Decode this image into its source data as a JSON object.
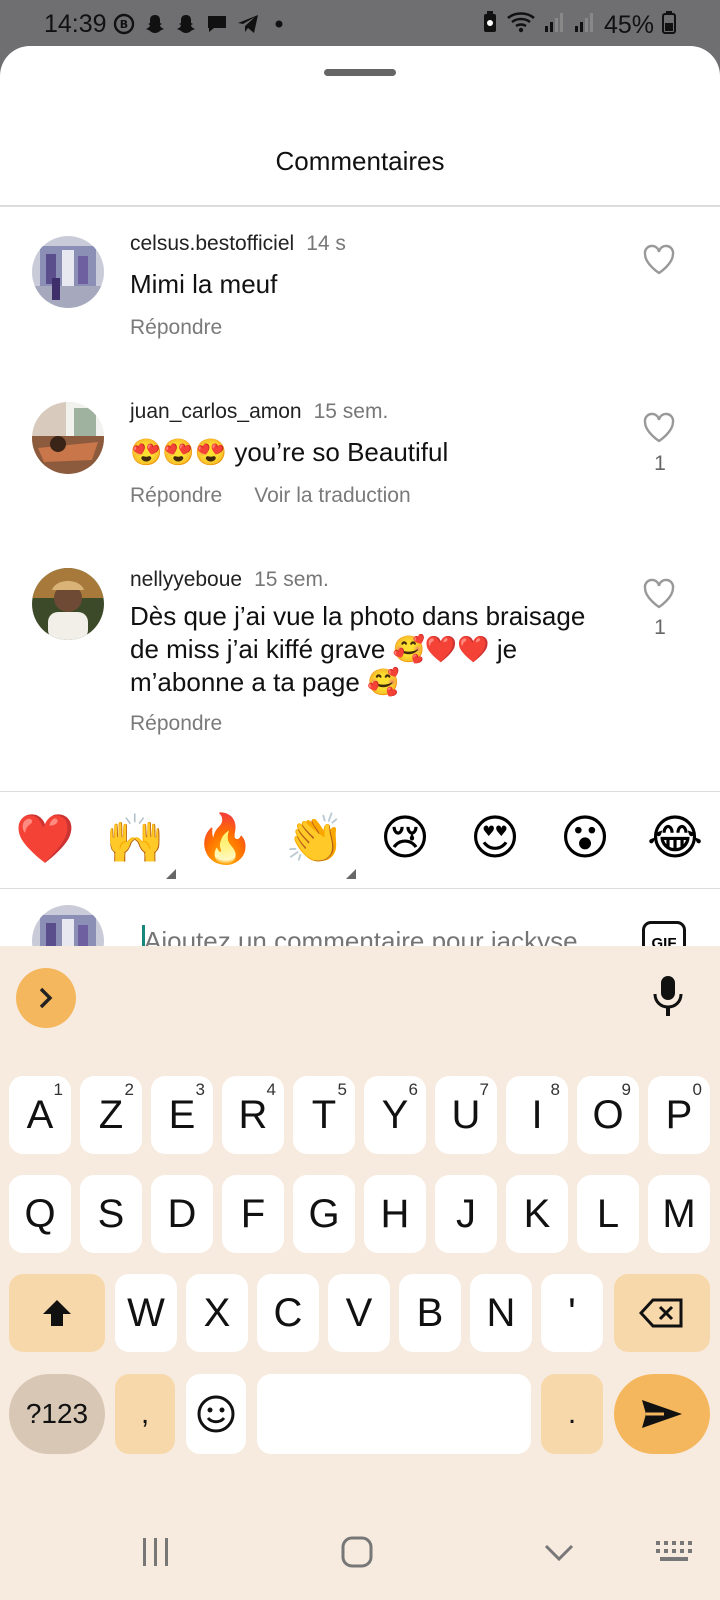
{
  "status_bar": {
    "time": "14:39",
    "battery": "45%",
    "left_icons": [
      "whatsapp-icon",
      "snapchat-icon",
      "snapchat-icon",
      "message-icon",
      "telegram-icon",
      "dot-icon"
    ],
    "right_icons": [
      "battery-saver-icon",
      "wifi-icon",
      "signal-icon",
      "signal-icon",
      "battery-icon"
    ]
  },
  "sheet": {
    "title": "Commentaires"
  },
  "comments": [
    {
      "username": "celsus.bestofficiel",
      "time": "14 s",
      "text": "Mimi la meuf",
      "reply": "Répondre",
      "translate": "",
      "likes": ""
    },
    {
      "username": "juan_carlos_amon",
      "time": "15 sem.",
      "text": "😍😍😍 you’re so Beautiful",
      "reply": "Répondre",
      "translate": "Voir la traduction",
      "likes": "1"
    },
    {
      "username": "nellyyeboue",
      "time": "15 sem.",
      "text": "Dès que j’ai vue la photo dans braisage de miss j’ai kiffé grave 🥰❤️❤️ je m’abonne a ta page 🥰",
      "reply": "Répondre",
      "translate": "",
      "likes": "1"
    }
  ],
  "reactions": [
    "❤️",
    "🙌",
    "🔥",
    "👏",
    "😢",
    "😍",
    "😮",
    "😂"
  ],
  "input": {
    "placeholder": "Ajoutez un commentaire pour jackyse",
    "gif_label": "GIF"
  },
  "keyboard": {
    "row1": [
      {
        "k": "A",
        "h": "1"
      },
      {
        "k": "Z",
        "h": "2"
      },
      {
        "k": "E",
        "h": "3"
      },
      {
        "k": "R",
        "h": "4"
      },
      {
        "k": "T",
        "h": "5"
      },
      {
        "k": "Y",
        "h": "6"
      },
      {
        "k": "U",
        "h": "7"
      },
      {
        "k": "I",
        "h": "8"
      },
      {
        "k": "O",
        "h": "9"
      },
      {
        "k": "P",
        "h": "0"
      }
    ],
    "row2": [
      "Q",
      "S",
      "D",
      "F",
      "G",
      "H",
      "J",
      "K",
      "L",
      "M"
    ],
    "row3": [
      "W",
      "X",
      "C",
      "V",
      "B",
      "N",
      "'"
    ],
    "symbols_label": "?123",
    "comma": ",",
    "period": "."
  },
  "colors": {
    "keyboard_bg": "#f7ebe0",
    "accent": "#f5b75e",
    "func_key": "#f7d8aa",
    "caret": "#16877a"
  }
}
